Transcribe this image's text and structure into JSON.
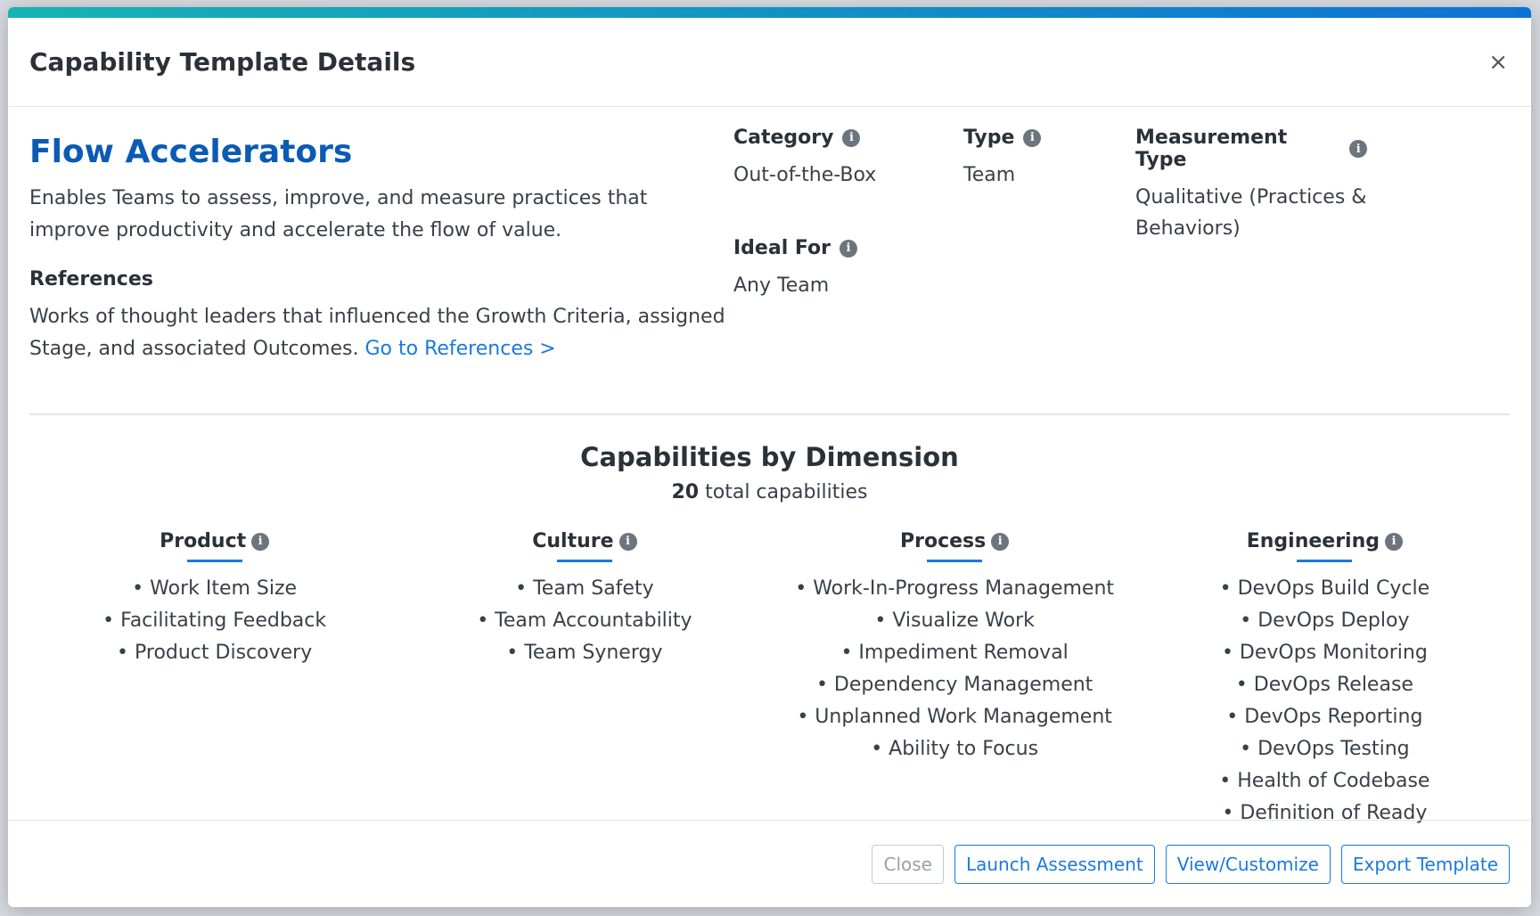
{
  "modal": {
    "title": "Capability Template Details",
    "close_icon": "×"
  },
  "template": {
    "name": "Flow Accelerators",
    "description": "Enables Teams to assess, improve, and measure practices that improve productivity and accelerate the flow of value.",
    "references_heading": "References",
    "references_text": "Works of thought leaders that influenced the Growth Criteria, assigned Stage, and associated Outcomes.",
    "references_link": "Go to References >"
  },
  "meta": {
    "category": {
      "label": "Category",
      "value": "Out-of-the-Box"
    },
    "type": {
      "label": "Type",
      "value": "Team"
    },
    "measurement_type": {
      "label": "Measurement Type",
      "value": "Qualitative (Practices & Behaviors)"
    },
    "ideal_for": {
      "label": "Ideal For",
      "value": "Any Team"
    }
  },
  "dimensions_section": {
    "title": "Capabilities by Dimension",
    "total_count": "20",
    "total_label": "total capabilities"
  },
  "dimensions": [
    {
      "name": "Product",
      "items": [
        "• Work Item Size",
        "• Facilitating Feedback",
        "• Product Discovery"
      ]
    },
    {
      "name": "Culture",
      "items": [
        "• Team Safety",
        "• Team Accountability",
        "• Team Synergy"
      ]
    },
    {
      "name": "Process",
      "items": [
        "• Work-In-Progress Management",
        "• Visualize Work",
        "• Impediment Removal",
        "• Dependency Management",
        "• Unplanned Work Management",
        "• Ability to Focus"
      ]
    },
    {
      "name": "Engineering",
      "items": [
        "• DevOps Build Cycle",
        "• DevOps Deploy",
        "• DevOps Monitoring",
        "• DevOps Release",
        "• DevOps Reporting",
        "• DevOps Testing",
        "• Health of Codebase",
        "• Definition of Ready"
      ]
    }
  ],
  "footer": {
    "close": "Close",
    "launch": "Launch Assessment",
    "view_customize": "View/Customize",
    "export": "Export Template"
  },
  "info_icon_glyph": "i"
}
